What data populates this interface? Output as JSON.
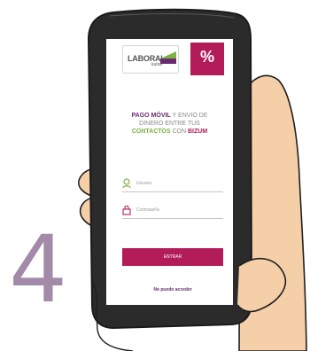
{
  "brand": {
    "logo_word": "LABORAL",
    "logo_sub": "kutxa",
    "bizum_mark": "%"
  },
  "promo": {
    "pago_movil": "PAGO MÓVIL",
    "text1": " Y ENVIO DE",
    "text2": "DINERO ENTRE TUS",
    "contactos": "CONTACTOS",
    "con": " CON ",
    "bizum": "BIZUM"
  },
  "form": {
    "user_placeholder": "Usuario",
    "password_placeholder": "Contraseña",
    "enter_label": "ENTRAR",
    "forgot_label": "No puedo acceder"
  },
  "step_number": "4",
  "colors": {
    "brand_red": "#b21c58",
    "brand_purple": "#6a2b73",
    "brand_green": "#7cb341",
    "step_number": "#a38aa8",
    "skin": "#f5cfa8"
  },
  "icons": {
    "user": "user-icon",
    "lock": "lock-icon"
  }
}
